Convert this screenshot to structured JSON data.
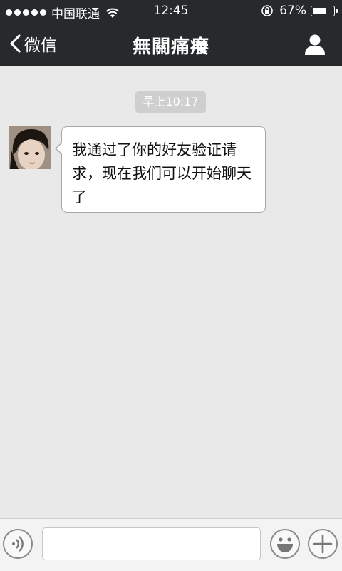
{
  "status_bar": {
    "carrier": "中国联通",
    "time": "12:45",
    "battery_percent": "67%",
    "battery_level": 0.67
  },
  "nav": {
    "back_label": "微信",
    "title": "無關痛癢"
  },
  "chat": {
    "timestamp": "早上10:17",
    "messages": [
      {
        "text": "我通过了你的好友验证请求，现在我们可以开始聊天了"
      }
    ]
  },
  "input": {
    "placeholder": ""
  },
  "icons": {
    "back": "chevron-left-icon",
    "profile": "person-icon",
    "voice": "voice-icon",
    "emoji": "emoji-icon",
    "plus": "plus-icon"
  },
  "colors": {
    "nav_bg": "#262a2d",
    "chat_bg": "#e9e9e9",
    "bubble_bg": "#ffffff"
  }
}
